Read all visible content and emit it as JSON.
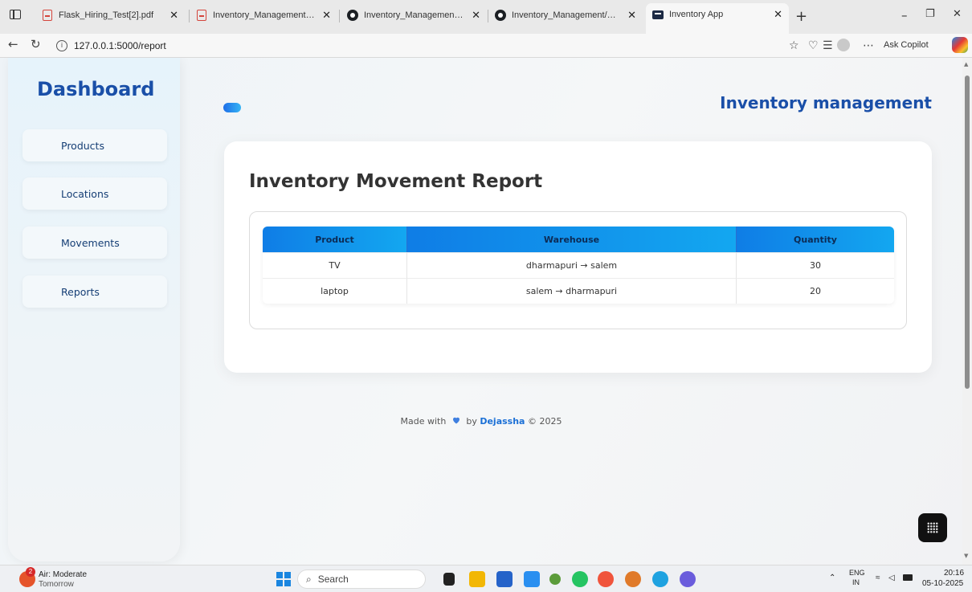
{
  "browser": {
    "tabs": [
      {
        "label": "Flask_Hiring_Test[2].pdf",
        "icon": "pdf-icon"
      },
      {
        "label": "Inventory_Management_System_",
        "icon": "pdf-icon"
      },
      {
        "label": "Inventory_Management/README",
        "icon": "github-icon"
      },
      {
        "label": "Inventory_Management/README",
        "icon": "github-icon"
      },
      {
        "label": "Inventory App",
        "icon": "app-icon",
        "active": true
      }
    ],
    "url": "127.0.0.1:5000/report",
    "copilot_label": "Ask Copilot"
  },
  "sidebar": {
    "title": "Dashboard",
    "items": [
      {
        "label": "Products"
      },
      {
        "label": "Locations"
      },
      {
        "label": "Movements"
      },
      {
        "label": "Reports"
      }
    ]
  },
  "header": {
    "brand": "Inventory management"
  },
  "report": {
    "title": "Inventory Movement Report",
    "columns": [
      "Product",
      "Warehouse",
      "Quantity"
    ],
    "rows": [
      {
        "product": "TV",
        "warehouse": "dharmapuri → salem",
        "quantity": "30"
      },
      {
        "product": "laptop",
        "warehouse": "salem → dharmapuri",
        "quantity": "20"
      }
    ]
  },
  "footer": {
    "prefix": "Made with",
    "by": "by",
    "author": "Dejassha",
    "suffix": "© 2025"
  },
  "taskbar": {
    "weather_title": "Air: Moderate",
    "weather_sub": "Tomorrow",
    "weather_badge": "2",
    "search_placeholder": "Search",
    "lang_top": "ENG",
    "lang_bottom": "IN",
    "time": "20:16",
    "date": "05-10-2025"
  },
  "colors": {
    "accent": "#1a4fa8",
    "table_header_start": "#0f7de6",
    "table_header_end": "#13a7f0"
  }
}
